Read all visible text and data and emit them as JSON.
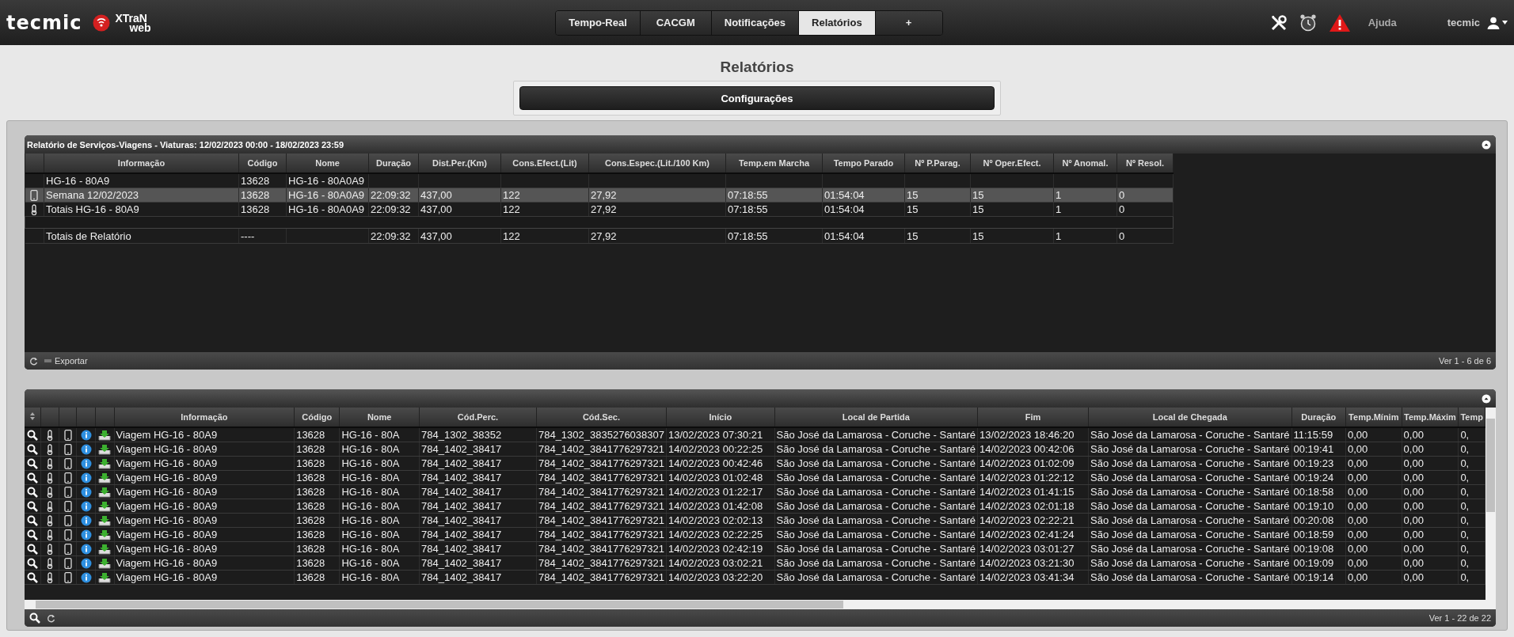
{
  "header": {
    "logo_text": "tecmic",
    "product_text": "XTraN",
    "product_subtext": "web",
    "tabs": [
      {
        "label": "Tempo-Real",
        "selected": false
      },
      {
        "label": "CACGM",
        "selected": false
      },
      {
        "label": "Notificações",
        "selected": false
      },
      {
        "label": "Relatórios",
        "selected": true
      },
      {
        "label": "+",
        "selected": false
      }
    ],
    "help": "Ajuda",
    "user": "tecmic"
  },
  "page_title": "Relatórios",
  "config_button": "Configurações",
  "summary_grid": {
    "title": "Relatório de Serviços-Viagens - Viaturas: 12/02/2023 00:00 - 18/02/2023 23:59",
    "columns": [
      "Informação",
      "Código",
      "Nome",
      "Duração",
      "Dist.Per.(Km)",
      "Cons.Efect.(Lit)",
      "Cons.Espec.(Lit./100 Km)",
      "Temp.em Marcha",
      "Tempo Parado",
      "Nº P.Parag.",
      "Nº Oper.Efect.",
      "Nº Anomal.",
      "Nº Resol."
    ],
    "rows": [
      {
        "kind": "group",
        "selected": false,
        "cells": [
          "HG-16 - 80A9",
          "13628",
          "HG-16 - 80A0A9",
          "",
          "",
          "",
          "",
          "",
          "",
          "",
          "",
          "",
          ""
        ]
      },
      {
        "kind": "week",
        "selected": true,
        "cells": [
          "Semana 12/02/2023",
          "13628",
          "HG-16 - 80A0A9",
          "22:09:32",
          "437,00",
          "122",
          "27,92",
          "07:18:55",
          "01:54:04",
          "15",
          "15",
          "1",
          "0"
        ]
      },
      {
        "kind": "totals",
        "selected": false,
        "cells": [
          "Totais HG-16 - 80A9",
          "13628",
          "HG-16 - 80A0A9",
          "22:09:32",
          "437,00",
          "122",
          "27,92",
          "07:18:55",
          "01:54:04",
          "15",
          "15",
          "1",
          "0"
        ]
      },
      {
        "kind": "spacer",
        "selected": false,
        "cells": []
      },
      {
        "kind": "report_totals",
        "selected": false,
        "cells": [
          "Totais de Relatório",
          "----",
          "",
          "22:09:32",
          "437,00",
          "122",
          "27,92",
          "07:18:55",
          "01:54:04",
          "15",
          "15",
          "1",
          "0"
        ]
      }
    ],
    "export": "Exportar",
    "pager": "Ver 1 - 6 de 6"
  },
  "trips_grid": {
    "columns": [
      "Informação",
      "Código",
      "Nome",
      "Cód.Perc.",
      "Cód.Sec.",
      "Início",
      "Local de Partida",
      "Fim",
      "Local de Chegada",
      "Duração",
      "Temp.Mínim",
      "Temp.Máxim",
      "Temp"
    ],
    "rows": [
      [
        "Viagem HG-16 - 80A9",
        "13628",
        "HG-16 - 80A",
        "784_1302_38352",
        "784_1302_3835276038307",
        "13/02/2023 07:30:21",
        "São José da Lamarosa - Coruche - Santaré",
        "13/02/2023 18:46:20",
        "São José da Lamarosa - Coruche - Santaré",
        "11:15:59",
        "0,00",
        "0,00",
        "0,"
      ],
      [
        "Viagem HG-16 - 80A9",
        "13628",
        "HG-16 - 80A",
        "784_1402_38417",
        "784_1402_3841776297321",
        "14/02/2023 00:22:25",
        "São José da Lamarosa - Coruche - Santaré",
        "14/02/2023 00:42:06",
        "São José da Lamarosa - Coruche - Santaré",
        "00:19:41",
        "0,00",
        "0,00",
        "0,"
      ],
      [
        "Viagem HG-16 - 80A9",
        "13628",
        "HG-16 - 80A",
        "784_1402_38417",
        "784_1402_3841776297321",
        "14/02/2023 00:42:46",
        "São José da Lamarosa - Coruche - Santaré",
        "14/02/2023 01:02:09",
        "São José da Lamarosa - Coruche - Santaré",
        "00:19:23",
        "0,00",
        "0,00",
        "0,"
      ],
      [
        "Viagem HG-16 - 80A9",
        "13628",
        "HG-16 - 80A",
        "784_1402_38417",
        "784_1402_3841776297321",
        "14/02/2023 01:02:48",
        "São José da Lamarosa - Coruche - Santaré",
        "14/02/2023 01:22:12",
        "São José da Lamarosa - Coruche - Santaré",
        "00:19:24",
        "0,00",
        "0,00",
        "0,"
      ],
      [
        "Viagem HG-16 - 80A9",
        "13628",
        "HG-16 - 80A",
        "784_1402_38417",
        "784_1402_3841776297321",
        "14/02/2023 01:22:17",
        "São José da Lamarosa - Coruche - Santaré",
        "14/02/2023 01:41:15",
        "São José da Lamarosa - Coruche - Santaré",
        "00:18:58",
        "0,00",
        "0,00",
        "0,"
      ],
      [
        "Viagem HG-16 - 80A9",
        "13628",
        "HG-16 - 80A",
        "784_1402_38417",
        "784_1402_3841776297321",
        "14/02/2023 01:42:08",
        "São José da Lamarosa - Coruche - Santaré",
        "14/02/2023 02:01:18",
        "São José da Lamarosa - Coruche - Santaré",
        "00:19:10",
        "0,00",
        "0,00",
        "0,"
      ],
      [
        "Viagem HG-16 - 80A9",
        "13628",
        "HG-16 - 80A",
        "784_1402_38417",
        "784_1402_3841776297321",
        "14/02/2023 02:02:13",
        "São José da Lamarosa - Coruche - Santaré",
        "14/02/2023 02:22:21",
        "São José da Lamarosa - Coruche - Santaré",
        "00:20:08",
        "0,00",
        "0,00",
        "0,"
      ],
      [
        "Viagem HG-16 - 80A9",
        "13628",
        "HG-16 - 80A",
        "784_1402_38417",
        "784_1402_3841776297321",
        "14/02/2023 02:22:25",
        "São José da Lamarosa - Coruche - Santaré",
        "14/02/2023 02:41:24",
        "São José da Lamarosa - Coruche - Santaré",
        "00:18:59",
        "0,00",
        "0,00",
        "0,"
      ],
      [
        "Viagem HG-16 - 80A9",
        "13628",
        "HG-16 - 80A",
        "784_1402_38417",
        "784_1402_3841776297321",
        "14/02/2023 02:42:19",
        "São José da Lamarosa - Coruche - Santaré",
        "14/02/2023 03:01:27",
        "São José da Lamarosa - Coruche - Santaré",
        "00:19:08",
        "0,00",
        "0,00",
        "0,"
      ],
      [
        "Viagem HG-16 - 80A9",
        "13628",
        "HG-16 - 80A",
        "784_1402_38417",
        "784_1402_3841776297321",
        "14/02/2023 03:02:21",
        "São José da Lamarosa - Coruche - Santaré",
        "14/02/2023 03:21:30",
        "São José da Lamarosa - Coruche - Santaré",
        "00:19:09",
        "0,00",
        "0,00",
        "0,"
      ],
      [
        "Viagem HG-16 - 80A9",
        "13628",
        "HG-16 - 80A",
        "784_1402_38417",
        "784_1402_3841776297321",
        "14/02/2023 03:22:20",
        "São José da Lamarosa - Coruche - Santaré",
        "14/02/2023 03:41:34",
        "São José da Lamarosa - Coruche - Santaré",
        "00:19:14",
        "0,00",
        "0,00",
        "0,"
      ]
    ],
    "pager": "Ver 1 - 22 de 22"
  }
}
